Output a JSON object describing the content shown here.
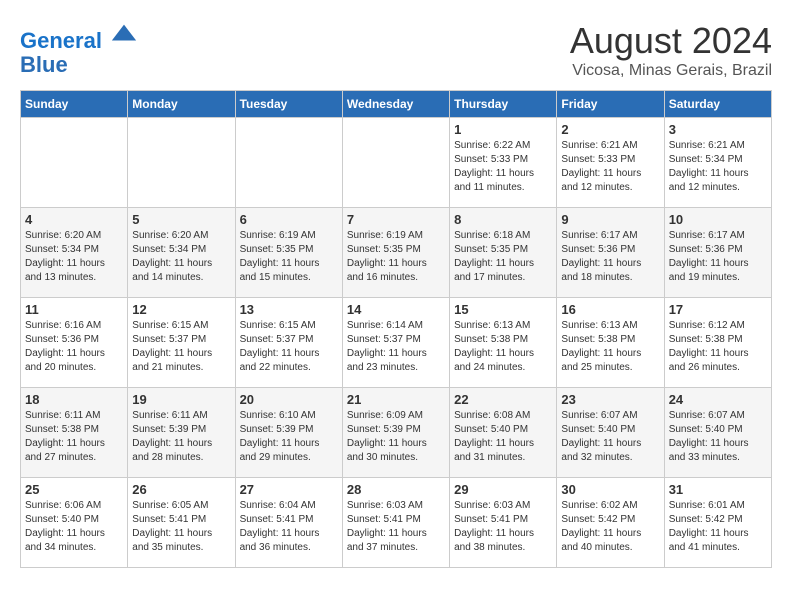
{
  "header": {
    "logo_line1": "General",
    "logo_line2": "Blue",
    "month": "August 2024",
    "location": "Vicosa, Minas Gerais, Brazil"
  },
  "weekdays": [
    "Sunday",
    "Monday",
    "Tuesday",
    "Wednesday",
    "Thursday",
    "Friday",
    "Saturday"
  ],
  "weeks": [
    [
      {
        "day": "",
        "info": ""
      },
      {
        "day": "",
        "info": ""
      },
      {
        "day": "",
        "info": ""
      },
      {
        "day": "",
        "info": ""
      },
      {
        "day": "1",
        "info": "Sunrise: 6:22 AM\nSunset: 5:33 PM\nDaylight: 11 hours and 11 minutes."
      },
      {
        "day": "2",
        "info": "Sunrise: 6:21 AM\nSunset: 5:33 PM\nDaylight: 11 hours and 12 minutes."
      },
      {
        "day": "3",
        "info": "Sunrise: 6:21 AM\nSunset: 5:34 PM\nDaylight: 11 hours and 12 minutes."
      }
    ],
    [
      {
        "day": "4",
        "info": "Sunrise: 6:20 AM\nSunset: 5:34 PM\nDaylight: 11 hours and 13 minutes."
      },
      {
        "day": "5",
        "info": "Sunrise: 6:20 AM\nSunset: 5:34 PM\nDaylight: 11 hours and 14 minutes."
      },
      {
        "day": "6",
        "info": "Sunrise: 6:19 AM\nSunset: 5:35 PM\nDaylight: 11 hours and 15 minutes."
      },
      {
        "day": "7",
        "info": "Sunrise: 6:19 AM\nSunset: 5:35 PM\nDaylight: 11 hours and 16 minutes."
      },
      {
        "day": "8",
        "info": "Sunrise: 6:18 AM\nSunset: 5:35 PM\nDaylight: 11 hours and 17 minutes."
      },
      {
        "day": "9",
        "info": "Sunrise: 6:17 AM\nSunset: 5:36 PM\nDaylight: 11 hours and 18 minutes."
      },
      {
        "day": "10",
        "info": "Sunrise: 6:17 AM\nSunset: 5:36 PM\nDaylight: 11 hours and 19 minutes."
      }
    ],
    [
      {
        "day": "11",
        "info": "Sunrise: 6:16 AM\nSunset: 5:36 PM\nDaylight: 11 hours and 20 minutes."
      },
      {
        "day": "12",
        "info": "Sunrise: 6:15 AM\nSunset: 5:37 PM\nDaylight: 11 hours and 21 minutes."
      },
      {
        "day": "13",
        "info": "Sunrise: 6:15 AM\nSunset: 5:37 PM\nDaylight: 11 hours and 22 minutes."
      },
      {
        "day": "14",
        "info": "Sunrise: 6:14 AM\nSunset: 5:37 PM\nDaylight: 11 hours and 23 minutes."
      },
      {
        "day": "15",
        "info": "Sunrise: 6:13 AM\nSunset: 5:38 PM\nDaylight: 11 hours and 24 minutes."
      },
      {
        "day": "16",
        "info": "Sunrise: 6:13 AM\nSunset: 5:38 PM\nDaylight: 11 hours and 25 minutes."
      },
      {
        "day": "17",
        "info": "Sunrise: 6:12 AM\nSunset: 5:38 PM\nDaylight: 11 hours and 26 minutes."
      }
    ],
    [
      {
        "day": "18",
        "info": "Sunrise: 6:11 AM\nSunset: 5:38 PM\nDaylight: 11 hours and 27 minutes."
      },
      {
        "day": "19",
        "info": "Sunrise: 6:11 AM\nSunset: 5:39 PM\nDaylight: 11 hours and 28 minutes."
      },
      {
        "day": "20",
        "info": "Sunrise: 6:10 AM\nSunset: 5:39 PM\nDaylight: 11 hours and 29 minutes."
      },
      {
        "day": "21",
        "info": "Sunrise: 6:09 AM\nSunset: 5:39 PM\nDaylight: 11 hours and 30 minutes."
      },
      {
        "day": "22",
        "info": "Sunrise: 6:08 AM\nSunset: 5:40 PM\nDaylight: 11 hours and 31 minutes."
      },
      {
        "day": "23",
        "info": "Sunrise: 6:07 AM\nSunset: 5:40 PM\nDaylight: 11 hours and 32 minutes."
      },
      {
        "day": "24",
        "info": "Sunrise: 6:07 AM\nSunset: 5:40 PM\nDaylight: 11 hours and 33 minutes."
      }
    ],
    [
      {
        "day": "25",
        "info": "Sunrise: 6:06 AM\nSunset: 5:40 PM\nDaylight: 11 hours and 34 minutes."
      },
      {
        "day": "26",
        "info": "Sunrise: 6:05 AM\nSunset: 5:41 PM\nDaylight: 11 hours and 35 minutes."
      },
      {
        "day": "27",
        "info": "Sunrise: 6:04 AM\nSunset: 5:41 PM\nDaylight: 11 hours and 36 minutes."
      },
      {
        "day": "28",
        "info": "Sunrise: 6:03 AM\nSunset: 5:41 PM\nDaylight: 11 hours and 37 minutes."
      },
      {
        "day": "29",
        "info": "Sunrise: 6:03 AM\nSunset: 5:41 PM\nDaylight: 11 hours and 38 minutes."
      },
      {
        "day": "30",
        "info": "Sunrise: 6:02 AM\nSunset: 5:42 PM\nDaylight: 11 hours and 40 minutes."
      },
      {
        "day": "31",
        "info": "Sunrise: 6:01 AM\nSunset: 5:42 PM\nDaylight: 11 hours and 41 minutes."
      }
    ]
  ]
}
